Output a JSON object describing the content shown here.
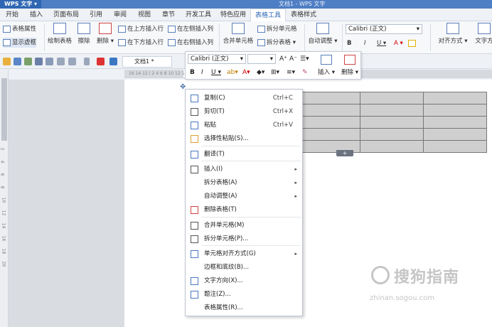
{
  "titlebar": {
    "app": "WPS 文字 ▾",
    "doc_title": "文档1 - WPS 文字"
  },
  "menu_tabs": [
    "开始",
    "插入",
    "页面布局",
    "引用",
    "审阅",
    "视图",
    "章节",
    "开发工具",
    "特色应用",
    "表格工具",
    "表格样式"
  ],
  "active_tab": "表格工具",
  "ribbon": {
    "table_props": "表格属性",
    "show_gridlines": "显示虚框",
    "draw_table": "绘制表格",
    "erase": "擦除",
    "delete": "删除 ▾",
    "insert_above": "在上方插入行",
    "insert_below": "在下方插入行",
    "insert_left": "在左侧插入列",
    "insert_right": "在右侧插入列",
    "merge_cells": "合并单元格",
    "split_cells": "拆分单元格",
    "split_table": "拆分表格 ▾",
    "auto_fit": "自动调整 ▾",
    "font_name": "Calibri (正文)",
    "bold": "B",
    "italic": "I",
    "underline": "U ▾",
    "font_color": "A ▾",
    "align": "对齐方式 ▾",
    "text_dir": "文字方"
  },
  "quickbar": {
    "doc_tab": "文档1 *"
  },
  "ruler_text": "16 14 12 | 2 4 6 8 10 12 14 16 18 20 22 |26 28 30 32 34 |36 |38",
  "ruler_v_nums": [
    "2",
    "4",
    "6",
    "8",
    "10",
    "12",
    "14",
    "16",
    "18",
    "20"
  ],
  "minibar": {
    "font": "Calibri (正文)",
    "size_arrow": "▾",
    "grow": "A⁺",
    "shrink": "A⁻",
    "bold": "B",
    "italic": "I",
    "underline": "U ▾",
    "insert": "插入 ▾",
    "delete": "删除 ▾"
  },
  "context_menu": [
    {
      "label": "复制(C)",
      "shortcut": "Ctrl+C",
      "icon": "copy-icon",
      "color": "#4a78c0"
    },
    {
      "label": "剪切(T)",
      "shortcut": "Ctrl+X",
      "icon": "scissors-icon",
      "color": "#555555"
    },
    {
      "label": "粘贴",
      "shortcut": "Ctrl+V",
      "icon": "paste-icon",
      "color": "#4a78c0"
    },
    {
      "label": "选择性粘贴(S)...",
      "shortcut": "",
      "icon": "paste-special-icon",
      "color": "#e0a030"
    },
    {
      "label": "翻译(T)",
      "shortcut": "",
      "icon": "translate-icon",
      "color": "#4a78c0"
    },
    {
      "label": "插入(I)",
      "shortcut": "",
      "icon": "table-insert-icon",
      "color": "#555555",
      "submenu": true
    },
    {
      "label": "拆分表格(A)",
      "shortcut": "",
      "icon": "",
      "color": "",
      "submenu": true
    },
    {
      "label": "自动调整(A)",
      "shortcut": "",
      "icon": "",
      "color": "",
      "submenu": true
    },
    {
      "label": "删除表格(T)",
      "shortcut": "",
      "icon": "delete-table-icon",
      "color": "#d04040"
    },
    {
      "label": "合并单元格(M)",
      "shortcut": "",
      "icon": "merge-cells-icon",
      "color": "#555555"
    },
    {
      "label": "拆分单元格(P)...",
      "shortcut": "",
      "icon": "split-cells-icon",
      "color": "#555555"
    },
    {
      "label": "单元格对齐方式(G)",
      "shortcut": "",
      "icon": "cell-align-icon",
      "color": "#4a78c0",
      "submenu": true
    },
    {
      "label": "边框和底纹(B)...",
      "shortcut": "",
      "icon": "",
      "color": ""
    },
    {
      "label": "文字方向(X)...",
      "shortcut": "",
      "icon": "text-direction-icon",
      "color": "#4a78c0"
    },
    {
      "label": "题注(Z)...",
      "shortcut": "",
      "icon": "caption-icon",
      "color": "#4a78c0"
    },
    {
      "label": "表格属性(R)...",
      "shortcut": "",
      "icon": "",
      "color": ""
    }
  ],
  "table": {
    "rows": 5,
    "cols": 3
  },
  "add_row_symbol": "+",
  "watermark": {
    "main": "搜狗指南",
    "sub": "zhinan.sogou.com"
  }
}
